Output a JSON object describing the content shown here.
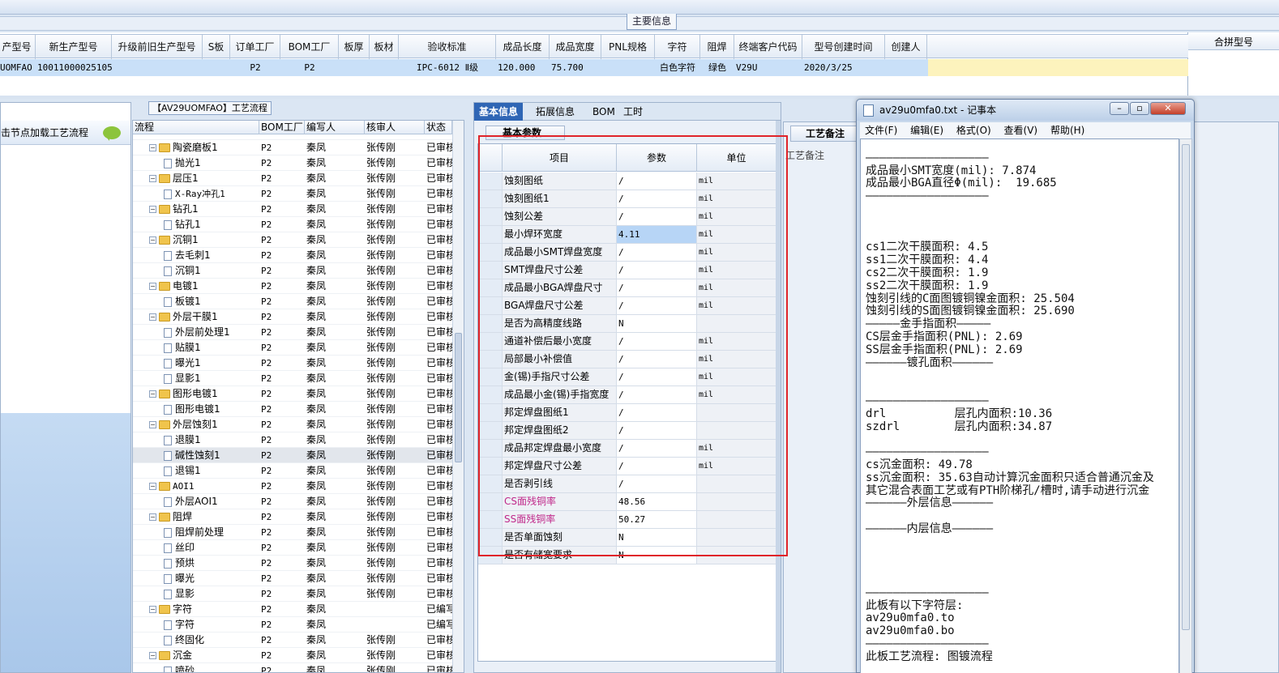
{
  "main_info_label": "主要信息",
  "main_grid": {
    "headers": [
      "产型号",
      "新生产型号",
      "升级前旧生产型号",
      "S板",
      "订单工厂",
      "BOM工厂",
      "板厚",
      "板材",
      "验收标准",
      "成品长度",
      "成品宽度",
      "PNL规格",
      "字符",
      "阻焊",
      "终端客户代码",
      "型号创建时间",
      "创建人"
    ],
    "row": [
      "UOMFAO",
      "10011000025105",
      "",
      "",
      "P2",
      "P2",
      "",
      "",
      "IPC-6012 Ⅱ级",
      "120.000",
      "75.700",
      "",
      "白色字符",
      "绿色",
      "V29U",
      "2020/3/25",
      ""
    ]
  },
  "right_grid_header": "合拼型号",
  "left_panel": {
    "flow_title": "【AV29UOMFAO】工艺流程",
    "load_button": "击节点加载工艺流程"
  },
  "tree": {
    "headers": [
      "流程",
      "BOM工厂",
      "编写人",
      "核审人",
      "状态"
    ],
    "rows": [
      {
        "level": 0,
        "name": "",
        "bom": "",
        "writer": "",
        "reviewer": "",
        "status": "",
        "folder": false,
        "partial": true
      },
      {
        "level": 1,
        "name": "陶瓷磨板1",
        "bom": "P2",
        "writer": "秦凤",
        "reviewer": "张传刚",
        "status": "已审核",
        "folder": true
      },
      {
        "level": 2,
        "name": "抛光1",
        "bom": "P2",
        "writer": "秦凤",
        "reviewer": "张传刚",
        "status": "已审核",
        "folder": false
      },
      {
        "level": 1,
        "name": "层压1",
        "bom": "P2",
        "writer": "秦凤",
        "reviewer": "张传刚",
        "status": "已审核",
        "folder": true
      },
      {
        "level": 2,
        "name": "X-Ray冲孔1",
        "bom": "P2",
        "writer": "秦凤",
        "reviewer": "张传刚",
        "status": "已审核",
        "folder": false
      },
      {
        "level": 1,
        "name": "钻孔1",
        "bom": "P2",
        "writer": "秦凤",
        "reviewer": "张传刚",
        "status": "已审核",
        "folder": true
      },
      {
        "level": 2,
        "name": "钻孔1",
        "bom": "P2",
        "writer": "秦凤",
        "reviewer": "张传刚",
        "status": "已审核",
        "folder": false
      },
      {
        "level": 1,
        "name": "沉铜1",
        "bom": "P2",
        "writer": "秦凤",
        "reviewer": "张传刚",
        "status": "已审核",
        "folder": true
      },
      {
        "level": 2,
        "name": "去毛刺1",
        "bom": "P2",
        "writer": "秦凤",
        "reviewer": "张传刚",
        "status": "已审核",
        "folder": false
      },
      {
        "level": 2,
        "name": "沉铜1",
        "bom": "P2",
        "writer": "秦凤",
        "reviewer": "张传刚",
        "status": "已审核",
        "folder": false
      },
      {
        "level": 1,
        "name": "电镀1",
        "bom": "P2",
        "writer": "秦凤",
        "reviewer": "张传刚",
        "status": "已审核",
        "folder": true
      },
      {
        "level": 2,
        "name": "板镀1",
        "bom": "P2",
        "writer": "秦凤",
        "reviewer": "张传刚",
        "status": "已审核",
        "folder": false
      },
      {
        "level": 1,
        "name": "外层干膜1",
        "bom": "P2",
        "writer": "秦凤",
        "reviewer": "张传刚",
        "status": "已审核",
        "folder": true
      },
      {
        "level": 2,
        "name": "外层前处理1",
        "bom": "P2",
        "writer": "秦凤",
        "reviewer": "张传刚",
        "status": "已审核",
        "folder": false
      },
      {
        "level": 2,
        "name": "贴膜1",
        "bom": "P2",
        "writer": "秦凤",
        "reviewer": "张传刚",
        "status": "已审核",
        "folder": false
      },
      {
        "level": 2,
        "name": "曝光1",
        "bom": "P2",
        "writer": "秦凤",
        "reviewer": "张传刚",
        "status": "已审核",
        "folder": false
      },
      {
        "level": 2,
        "name": "显影1",
        "bom": "P2",
        "writer": "秦凤",
        "reviewer": "张传刚",
        "status": "已审核",
        "folder": false
      },
      {
        "level": 1,
        "name": "图形电镀1",
        "bom": "P2",
        "writer": "秦凤",
        "reviewer": "张传刚",
        "status": "已审核",
        "folder": true
      },
      {
        "level": 2,
        "name": "图形电镀1",
        "bom": "P2",
        "writer": "秦凤",
        "reviewer": "张传刚",
        "status": "已审核",
        "folder": false
      },
      {
        "level": 1,
        "name": "外层蚀刻1",
        "bom": "P2",
        "writer": "秦凤",
        "reviewer": "张传刚",
        "status": "已审核",
        "folder": true
      },
      {
        "level": 2,
        "name": "退膜1",
        "bom": "P2",
        "writer": "秦凤",
        "reviewer": "张传刚",
        "status": "已审核",
        "folder": false
      },
      {
        "level": 2,
        "name": "碱性蚀刻1",
        "bom": "P2",
        "writer": "秦凤",
        "reviewer": "张传刚",
        "status": "已审核",
        "folder": false,
        "selected": true
      },
      {
        "level": 2,
        "name": "退锡1",
        "bom": "P2",
        "writer": "秦凤",
        "reviewer": "张传刚",
        "status": "已审核",
        "folder": false
      },
      {
        "level": 1,
        "name": "AOI1",
        "bom": "P2",
        "writer": "秦凤",
        "reviewer": "张传刚",
        "status": "已审核",
        "folder": true
      },
      {
        "level": 2,
        "name": "外层AOI1",
        "bom": "P2",
        "writer": "秦凤",
        "reviewer": "张传刚",
        "status": "已审核",
        "folder": false
      },
      {
        "level": 1,
        "name": "阻焊",
        "bom": "P2",
        "writer": "秦凤",
        "reviewer": "张传刚",
        "status": "已审核",
        "folder": true
      },
      {
        "level": 2,
        "name": "阻焊前处理",
        "bom": "P2",
        "writer": "秦凤",
        "reviewer": "张传刚",
        "status": "已审核",
        "folder": false
      },
      {
        "level": 2,
        "name": "丝印",
        "bom": "P2",
        "writer": "秦凤",
        "reviewer": "张传刚",
        "status": "已审核",
        "folder": false
      },
      {
        "level": 2,
        "name": "预烘",
        "bom": "P2",
        "writer": "秦凤",
        "reviewer": "张传刚",
        "status": "已审核",
        "folder": false
      },
      {
        "level": 2,
        "name": "曝光",
        "bom": "P2",
        "writer": "秦凤",
        "reviewer": "张传刚",
        "status": "已审核",
        "folder": false
      },
      {
        "level": 2,
        "name": "显影",
        "bom": "P2",
        "writer": "秦凤",
        "reviewer": "张传刚",
        "status": "已审核",
        "folder": false
      },
      {
        "level": 1,
        "name": "字符",
        "bom": "P2",
        "writer": "秦凤",
        "reviewer": "",
        "status": "已编写",
        "folder": true
      },
      {
        "level": 2,
        "name": "字符",
        "bom": "P2",
        "writer": "秦凤",
        "reviewer": "",
        "status": "已编写",
        "folder": false
      },
      {
        "level": 2,
        "name": "终固化",
        "bom": "P2",
        "writer": "秦凤",
        "reviewer": "张传刚",
        "status": "已审核",
        "folder": false
      },
      {
        "level": 1,
        "name": "沉金",
        "bom": "P2",
        "writer": "秦凤",
        "reviewer": "张传刚",
        "status": "已审核",
        "folder": true
      },
      {
        "level": 2,
        "name": "喷砂",
        "bom": "P2",
        "writer": "秦凤",
        "reviewer": "张传刚",
        "status": "已审核",
        "folder": false
      }
    ]
  },
  "center": {
    "tabs": [
      "基本信息",
      "拓展信息",
      "BOM",
      "工时"
    ],
    "subtab": "基本参数",
    "headers": [
      "项目",
      "参数",
      "单位"
    ],
    "rows": [
      {
        "item": "蚀刻图纸",
        "param": "/",
        "unit": "mil"
      },
      {
        "item": "蚀刻图纸1",
        "param": "/",
        "unit": "mil"
      },
      {
        "item": "蚀刻公差",
        "param": "/",
        "unit": "mil"
      },
      {
        "item": "最小焊环宽度",
        "param": "4.11",
        "unit": "mil",
        "selected": true
      },
      {
        "item": "成品最小SMT焊盘宽度",
        "param": "/",
        "unit": "mil"
      },
      {
        "item": "SMT焊盘尺寸公差",
        "param": "/",
        "unit": "mil"
      },
      {
        "item": "成品最小BGA焊盘尺寸",
        "param": "/",
        "unit": "mil"
      },
      {
        "item": "BGA焊盘尺寸公差",
        "param": "/",
        "unit": "mil"
      },
      {
        "item": "是否为高精度线路",
        "param": "N",
        "unit": ""
      },
      {
        "item": "通道补偿后最小宽度",
        "param": "/",
        "unit": "mil"
      },
      {
        "item": "局部最小补偿值",
        "param": "/",
        "unit": "mil"
      },
      {
        "item": "金(锡)手指尺寸公差",
        "param": "/",
        "unit": "mil"
      },
      {
        "item": "成品最小金(锡)手指宽度",
        "param": "/",
        "unit": "mil"
      },
      {
        "item": "邦定焊盘图纸1",
        "param": "/",
        "unit": ""
      },
      {
        "item": "邦定焊盘图纸2",
        "param": "/",
        "unit": ""
      },
      {
        "item": "成品邦定焊盘最小宽度",
        "param": "/",
        "unit": "mil"
      },
      {
        "item": "邦定焊盘尺寸公差",
        "param": "/",
        "unit": "mil"
      },
      {
        "item": "是否剥引线",
        "param": "/",
        "unit": ""
      },
      {
        "item": "CS面残铜率",
        "param": "48.56",
        "unit": "",
        "pink": true
      },
      {
        "item": "SS面残铜率",
        "param": "50.27",
        "unit": "",
        "pink": true
      },
      {
        "item": "是否单面蚀刻",
        "param": "N",
        "unit": ""
      },
      {
        "item": "是否有储宽要求",
        "param": "N",
        "unit": ""
      }
    ]
  },
  "right_panel": {
    "tab": "工艺备注",
    "label": "工艺备注"
  },
  "notepad": {
    "title": "av29u0mfa0.txt - 记事本",
    "menu": [
      "文件(F)",
      "编辑(E)",
      "格式(O)",
      "查看(V)",
      "帮助(H)"
    ],
    "lines": [
      "",
      "——————————————————",
      "成品最小SMT宽度(mil): 7.874",
      "成品最小BGA直径Φ(mil):  19.685",
      "——————————————————",
      "",
      "",
      "",
      "cs1二次干膜面积: 4.5",
      "ss1二次干膜面积: 4.4",
      "cs2二次干膜面积: 1.9",
      "ss2二次干膜面积: 1.9",
      "蚀刻引线的C面图镀铜镍金面积: 25.504",
      "蚀刻引线的S面图镀铜镍金面积: 25.690",
      "—————金手指面积—————",
      "CS层金手指面积(PNL): 2.69",
      "SS层金手指面积(PNL): 2.69",
      "——————镀孔面积——————",
      "",
      "",
      "——————————————————",
      "drl          层孔内面积:10.36",
      "szdrl        层孔内面积:34.87",
      "",
      "——————————————————",
      "cs沉金面积: 49.78",
      "ss沉金面积: 35.63自动计算沉金面积只适合普通沉金及",
      "其它混合表面工艺或有PTH阶梯孔/槽时,请手动进行沉金",
      "——————外层信息——————",
      "",
      "——————内层信息——————",
      "",
      "",
      "",
      "",
      "——————————————————",
      "此板有以下字符层:",
      "av29u0mfa0.to",
      "av29u0mfa0.bo",
      "——————————————————",
      "此板工艺流程: 图镀流程"
    ]
  }
}
